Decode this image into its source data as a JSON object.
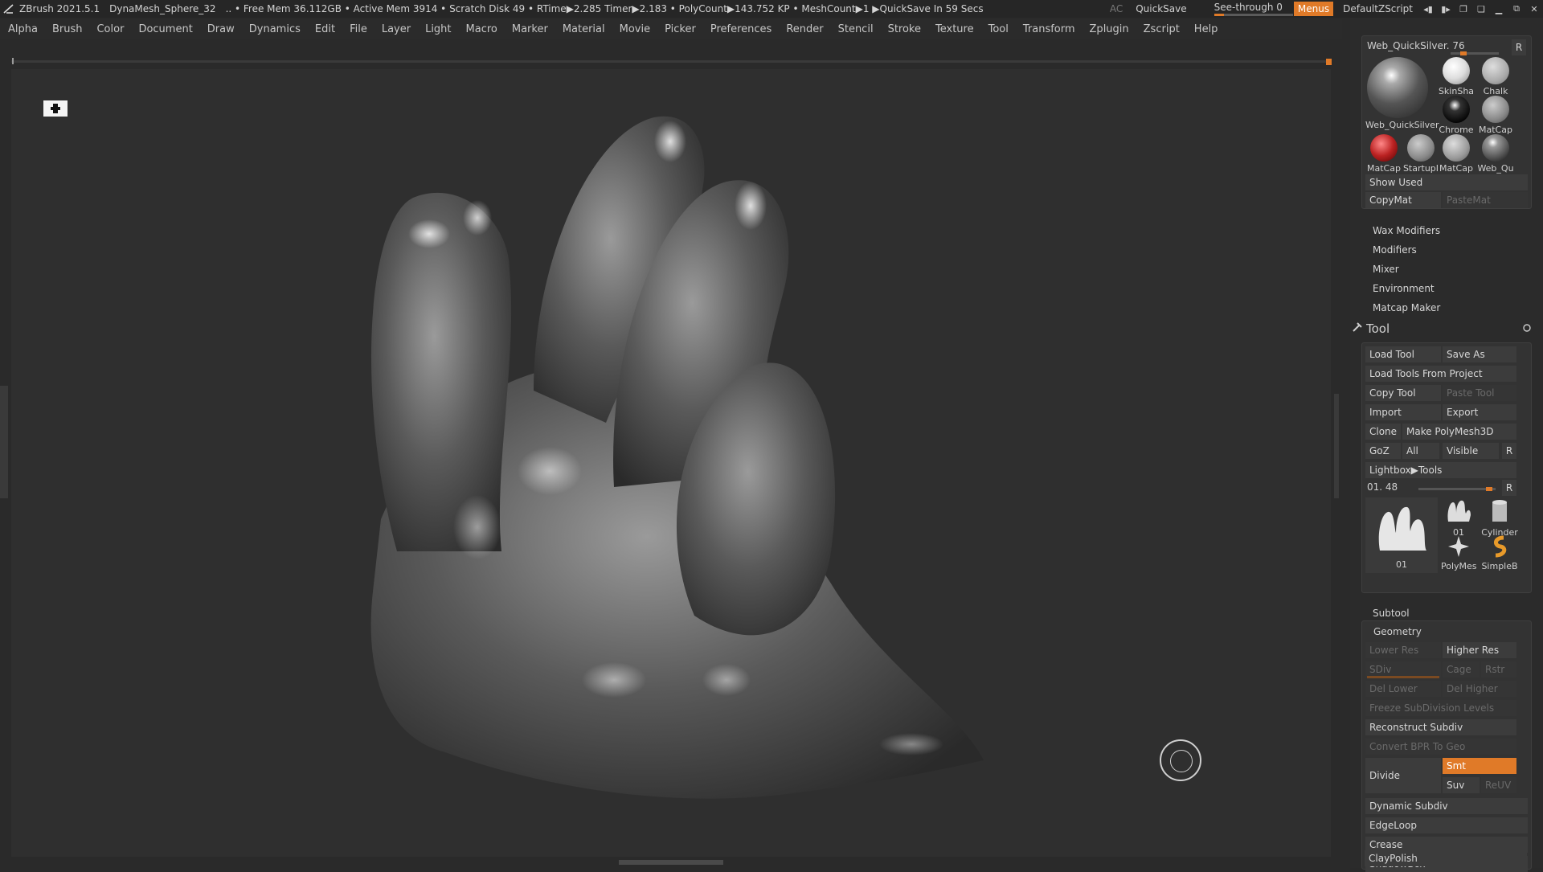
{
  "titlebar": {
    "app": "ZBrush 2021.5.1",
    "project": "DynaMesh_Sphere_32",
    "stats": ".. • Free Mem 36.112GB • Active Mem 3914 • Scratch Disk 49 •  RTime▶2.285 Timer▶2.183 • PolyCount▶143.752 KP  • MeshCount▶1  ▶QuickSave In 59 Secs",
    "ac": "AC",
    "quicksave": "QuickSave",
    "seethrough": "See-through  0",
    "seethrough_value": 0,
    "menus": "Menus",
    "script": "DefaultZScript"
  },
  "menubar": [
    "Alpha",
    "Brush",
    "Color",
    "Document",
    "Draw",
    "Dynamics",
    "Edit",
    "File",
    "Layer",
    "Light",
    "Macro",
    "Marker",
    "Material",
    "Movie",
    "Picker",
    "Preferences",
    "Render",
    "Stencil",
    "Stroke",
    "Texture",
    "Tool",
    "Transform",
    "Zplugin",
    "Zscript",
    "Help"
  ],
  "material": {
    "header": "Web_QuickSilver. 76",
    "header_r": "R",
    "big_label": "Web_QuickSilver",
    "items": [
      {
        "label": "SkinSha"
      },
      {
        "label": "Chalk"
      },
      {
        "label": "Chrome"
      },
      {
        "label": "MatCap"
      },
      {
        "label": "MatCap"
      },
      {
        "label": "StartupI"
      },
      {
        "label": "MatCap"
      },
      {
        "label": "Web_Qu"
      }
    ],
    "show_used": "Show Used",
    "copymat": "CopyMat",
    "pastemat": "PasteMat"
  },
  "submenus": [
    "Wax Modifiers",
    "Modifiers",
    "Mixer",
    "Environment",
    "Matcap Maker"
  ],
  "tool": {
    "title": "Tool",
    "load_tool": "Load Tool",
    "save_as": "Save As",
    "load_from_project": "Load Tools From Project",
    "copy_tool": "Copy Tool",
    "paste_tool": "Paste Tool",
    "import": "Import",
    "export": "Export",
    "clone": "Clone",
    "make_polymesh": "Make PolyMesh3D",
    "goz": "GoZ",
    "all": "All",
    "visible": "Visible",
    "r": "R",
    "lightbox": "Lightbox▶Tools",
    "slider_label": "01. 48",
    "slider_r": "R",
    "thumbs": {
      "main": "01",
      "small1": "01",
      "cylinder": "Cylinder",
      "polymesh": "PolyMes",
      "simpleb": "SimpleB"
    }
  },
  "geometry": {
    "subtool": "Subtool",
    "geometry": "Geometry",
    "lower_res": "Lower Res",
    "higher_res": "Higher Res",
    "sdiv": "SDiv",
    "cage": "Cage",
    "rstr": "Rstr",
    "del_lower": "Del Lower",
    "del_higher": "Del Higher",
    "freeze": "Freeze SubDivision Levels",
    "reconstruct": "Reconstruct Subdiv",
    "convert_bpr": "Convert BPR To Geo",
    "divide": "Divide",
    "smt": "Smt",
    "suv": "Suv",
    "reuv": "ReUV",
    "items": [
      "Dynamic Subdiv",
      "EdgeLoop",
      "Crease",
      "ShadowBox",
      "ClayPolish"
    ]
  },
  "colors": {
    "accent": "#e07a28",
    "panel": "#2b2b2b",
    "canvas": "#2f2f2f"
  }
}
